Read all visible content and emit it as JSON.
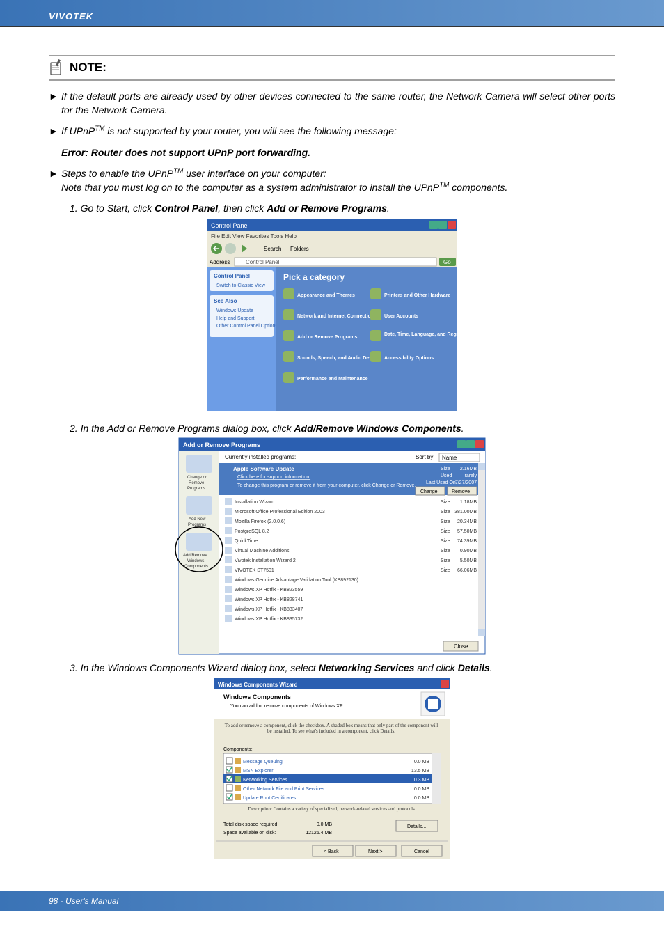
{
  "header": {
    "brand": "VIVOTEK"
  },
  "note": {
    "label": "NOTE:"
  },
  "bullets": [
    "If the default ports are already used by other devices connected to the same router, the Network Camera will select other ports for the Network Camera.",
    "If UPnPᵀᴹ is not supported by your router, you will see the following message:"
  ],
  "error_line": "Error: Router does not support UPnP port forwarding.",
  "steps_intro": "Steps to enable the UPnPᵀᴹ user interface on your computer:",
  "steps_note": "Note that you must log on to the computer as a system administrator to install the UPnPᵀᴹ components.",
  "step1_pre": "1. Go to Start, click ",
  "step1_b1": "Control Panel",
  "step1_mid": ", then click ",
  "step1_b2": "Add or Remove Programs",
  "step1_end": ".",
  "cp": {
    "title": "Control Panel",
    "menu": [
      "File",
      "Edit",
      "View",
      "Favorites",
      "Tools",
      "Help"
    ],
    "btn_search": "Search",
    "btn_folders": "Folders",
    "address_label": "Address",
    "address_value": "Control Panel",
    "go": "Go",
    "left_panel_title": "Control Panel",
    "switch_view": "Switch to Classic View",
    "see_also": "See Also",
    "see_also_items": [
      "Windows Update",
      "Help and Support",
      "Other Control Panel Options"
    ],
    "pick": "Pick a category",
    "cats": [
      "Appearance and Themes",
      "Printers and Other Hardware",
      "Network and Internet Connections",
      "User Accounts",
      "Add or Remove Programs",
      "Date, Time, Language, and Regional Options",
      "Sounds, Speech, and Audio Devices",
      "Accessibility Options",
      "Performance and Maintenance"
    ]
  },
  "step2_pre": "2. In the Add or Remove Programs dialog box, click ",
  "step2_b": "Add/Remove Windows Components",
  "step2_end": ".",
  "arp": {
    "title": "Add or Remove Programs",
    "currently": "Currently installed programs:",
    "sortby": "Sort by:",
    "sortval": "Name",
    "left": [
      "Change or Remove Programs",
      "Add New Programs",
      "Add/Remove Windows Components"
    ],
    "selected": {
      "name": "Apple Software Update",
      "support": "Click here for support information.",
      "change_text": "To change this program or remove it from your computer, click Change or Remove.",
      "size_label": "Size",
      "size": "2.16MB",
      "used_label": "Used",
      "used": "rarely",
      "lastused_label": "Last Used On",
      "lastused": "7/27/2007",
      "btn_change": "Change",
      "btn_remove": "Remove"
    },
    "rows": [
      {
        "name": "Installation Wizard",
        "size": "1.18MB"
      },
      {
        "name": "Microsoft Office Professional Edition 2003",
        "size": "381.00MB"
      },
      {
        "name": "Mozilla Firefox (2.0.0.6)",
        "size": "20.34MB"
      },
      {
        "name": "PostgreSQL 8.2",
        "size": "57.50MB"
      },
      {
        "name": "QuickTime",
        "size": "74.39MB"
      },
      {
        "name": "Virtual Machine Additions",
        "size": "0.90MB"
      },
      {
        "name": "Vivotek Installation Wizard 2",
        "size": "5.50MB"
      },
      {
        "name": "VIVOTEK ST7501",
        "size": "66.06MB"
      },
      {
        "name": "Windows Genuine Advantage Validation Tool (KB892130)",
        "size": ""
      },
      {
        "name": "Windows XP Hotfix - KB823559",
        "size": ""
      },
      {
        "name": "Windows XP Hotfix - KB828741",
        "size": ""
      },
      {
        "name": "Windows XP Hotfix - KB833407",
        "size": ""
      },
      {
        "name": "Windows XP Hotfix - KB835732",
        "size": ""
      }
    ],
    "size_label": "Size",
    "close": "Close"
  },
  "step3_pre": "3. In the Windows Components Wizard dialog box, select ",
  "step3_b1": "Networking Services",
  "step3_mid": " and click ",
  "step3_b2": "Details",
  "step3_end": ".",
  "wiz": {
    "title": "Windows Components Wizard",
    "heading": "Windows Components",
    "sub": "You can add or remove components of Windows XP.",
    "desc": "To add or remove a component, click the checkbox. A shaded box means that only part of the component will be installed. To see what's included in a component, click Details.",
    "components_label": "Components:",
    "rows": [
      {
        "checked": false,
        "name": "Message Queuing",
        "size": "0.0 MB"
      },
      {
        "checked": true,
        "name": "MSN Explorer",
        "size": "13.5 MB"
      },
      {
        "checked": true,
        "name": "Networking Services",
        "size": "0.3 MB",
        "selected": true
      },
      {
        "checked": false,
        "name": "Other Network File and Print Services",
        "size": "0.0 MB"
      },
      {
        "checked": true,
        "name": "Update Root Certificates",
        "size": "0.0 MB"
      }
    ],
    "row_desc": "Description:  Contains a variety of specialized, network-related services and protocols.",
    "total_label": "Total disk space required:",
    "total": "0.0 MB",
    "avail_label": "Space available on disk:",
    "avail": "12125.4 MB",
    "btn_details": "Details...",
    "btn_back": "< Back",
    "btn_next": "Next >",
    "btn_cancel": "Cancel"
  },
  "footer": {
    "label": "98 - User's Manual"
  }
}
